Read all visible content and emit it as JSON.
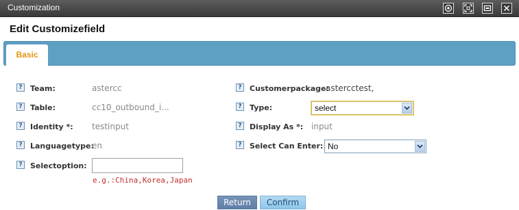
{
  "window": {
    "title": "Customization",
    "controls": [
      "restore-icon",
      "maximize-icon",
      "minimize-icon",
      "close-icon"
    ]
  },
  "heading": "Edit Customizefield",
  "tabs": [
    {
      "label": "Basic",
      "active": true
    }
  ],
  "fields": {
    "team": {
      "label": "Team:",
      "value": "astercc"
    },
    "customerpackage": {
      "label": "Customerpackage:",
      "value": "astercctest,"
    },
    "table": {
      "label": "Table:",
      "value": "cc10_outbound_i..."
    },
    "type": {
      "label": "Type:",
      "value": "select"
    },
    "identity": {
      "label": "Identity *:",
      "value": "testinput"
    },
    "display_as": {
      "label": "Display As *:",
      "value": "input"
    },
    "languagetype": {
      "label": "Languagetype:",
      "value": "en"
    },
    "select_can_enter": {
      "label": "Select Can Enter:",
      "value": "No"
    },
    "selectoption": {
      "label": "Selectoption:",
      "value": "",
      "hint": "e.g.:China,Korea,Japan"
    }
  },
  "help_glyph": "?",
  "buttons": {
    "return": "Return",
    "confirm": "Confirm"
  },
  "colors": {
    "tab_bar": "#5e9fc4",
    "tab_label": "#e49512",
    "hint": "#c0302a"
  }
}
